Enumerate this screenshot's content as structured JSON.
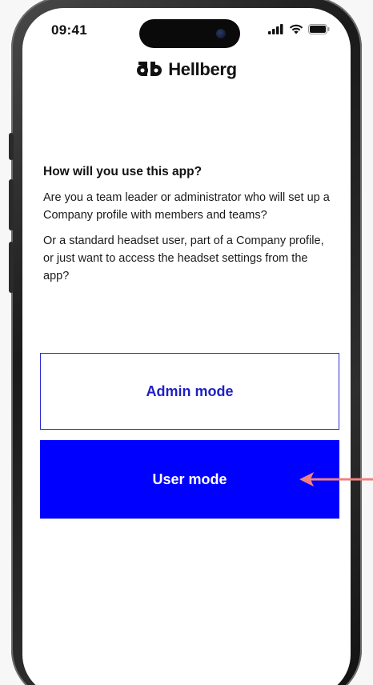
{
  "status_bar": {
    "time": "09:41"
  },
  "brand": {
    "name": "Hellberg"
  },
  "onboarding": {
    "heading": "How will you use this app?",
    "paragraph_1": "Are you a team leader or administrator who will set up a Company profile with members and teams?",
    "paragraph_2": "Or a standard headset user, part of a Company profile, or just want to access the headset settings from the app?"
  },
  "buttons": {
    "admin_label": "Admin mode",
    "user_label": "User mode"
  },
  "colors": {
    "accent": "#0000ff",
    "outline": "#2b2bd9",
    "annotation_arrow": "#f08080"
  },
  "icons": [
    "signal-icon",
    "wifi-icon",
    "battery-icon",
    "hellberg-logo-icon",
    "annotation-arrow-icon"
  ]
}
